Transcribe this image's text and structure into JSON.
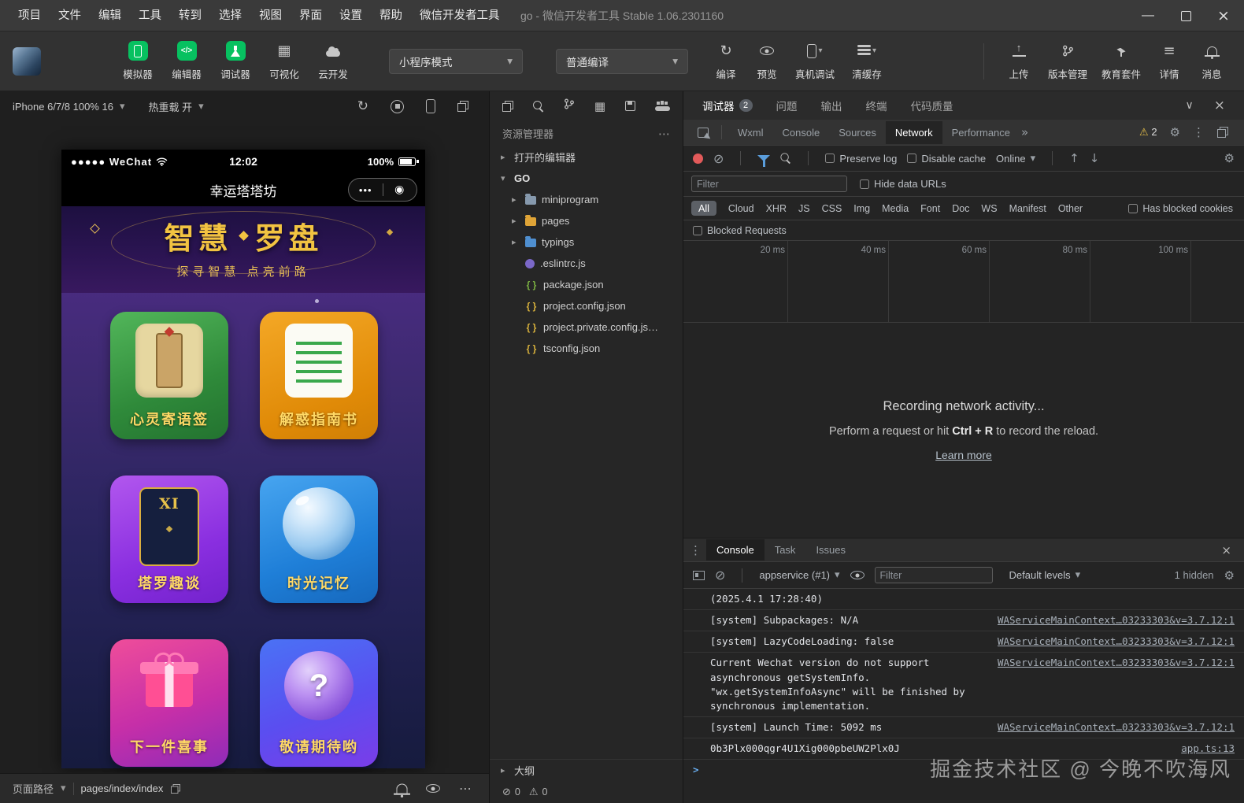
{
  "window": {
    "menu": [
      "项目",
      "文件",
      "编辑",
      "工具",
      "转到",
      "选择",
      "视图",
      "界面",
      "设置",
      "帮助",
      "微信开发者工具"
    ],
    "title": "go - 微信开发者工具 Stable 1.06.2301160"
  },
  "toolbar": {
    "simulator": "模拟器",
    "editor": "编辑器",
    "debugger": "调试器",
    "visual": "可视化",
    "cloud": "云开发",
    "mode_select": "小程序模式",
    "compile_select": "普通编译",
    "compile": "编译",
    "preview": "预览",
    "device_debug": "真机调试",
    "clear_cache": "清缓存",
    "upload": "上传",
    "version": "版本管理",
    "edu": "教育套件",
    "details": "详情",
    "messages": "消息"
  },
  "simulator": {
    "device": "iPhone 6/7/8 100% 16",
    "hot_reload": "热重载 开",
    "page_path_label": "页面路径",
    "page_path": "pages/index/index",
    "phone": {
      "carrier": "●●●●● WeChat",
      "time": "12:02",
      "battery": "100%",
      "nav_title": "幸运塔塔坊",
      "banner_title_left": "智慧",
      "banner_title_right": "罗盘",
      "banner_subtitle": "探寻智慧 点亮前路",
      "cards": [
        {
          "label": "心灵寄语签"
        },
        {
          "label": "解惑指南书"
        },
        {
          "label": "塔罗趣谈",
          "icon_text": "XI"
        },
        {
          "label": "时光记忆"
        },
        {
          "label": "下一件喜事"
        },
        {
          "label": "敬请期待哟",
          "icon_text": "?"
        }
      ]
    }
  },
  "explorer": {
    "title": "资源管理器",
    "open_editors": "打开的编辑器",
    "project": "GO",
    "items": [
      "miniprogram",
      "pages",
      "typings",
      ".eslintrc.js",
      "package.json",
      "project.config.json",
      "project.private.config.js…",
      "tsconfig.json"
    ],
    "outline": "大纲",
    "errors": "0",
    "warnings": "0"
  },
  "debugger": {
    "tabs": [
      "调试器",
      "问题",
      "输出",
      "终端",
      "代码质量"
    ],
    "badge": "2",
    "devtools_tabs": [
      "Wxml",
      "Console",
      "Sources",
      "Network",
      "Performance"
    ],
    "warn_count": "2",
    "network": {
      "preserve_log": "Preserve log",
      "disable_cache": "Disable cache",
      "throttling": "Online",
      "filter_placeholder": "Filter",
      "hide_data_urls": "Hide data URLs",
      "type_filters": [
        "All",
        "Cloud",
        "XHR",
        "JS",
        "CSS",
        "Img",
        "Media",
        "Font",
        "Doc",
        "WS",
        "Manifest",
        "Other"
      ],
      "has_blocked_cookies": "Has blocked cookies",
      "blocked_requests": "Blocked Requests",
      "timeline_ticks": [
        "20 ms",
        "40 ms",
        "60 ms",
        "80 ms",
        "100 ms"
      ],
      "empty_title": "Recording network activity...",
      "empty_pre": "Perform a request or hit ",
      "empty_key": "Ctrl + R",
      "empty_post": " to record the reload.",
      "learn_more": "Learn more"
    }
  },
  "console": {
    "tabs": [
      "Console",
      "Task",
      "Issues"
    ],
    "context": "appservice (#1)",
    "filter_placeholder": "Filter",
    "levels": "Default levels",
    "hidden": "1 hidden",
    "rows": [
      {
        "text": "(2025.4.1 17:28:40)",
        "link": ""
      },
      {
        "text": "[system] Subpackages: N/A",
        "link": "WAServiceMainContext…03233303&v=3.7.12:1"
      },
      {
        "text": "[system] LazyCodeLoading: false",
        "link": "WAServiceMainContext…03233303&v=3.7.12:1"
      },
      {
        "text": "Current Wechat version do not support asynchronous getSystemInfo. \"wx.getSystemInfoAsync\" will be finished by synchronous implementation.",
        "link": "WAServiceMainContext…03233303&v=3.7.12:1"
      },
      {
        "text": "[system] Launch Time: 5092 ms",
        "link": "WAServiceMainContext…03233303&v=3.7.12:1"
      },
      {
        "text": "0b3Plx000qgr4U1Xig000pbeUW2Plx0J",
        "link": "app.ts:13"
      }
    ]
  },
  "watermark": "掘金技术社区 @ 今晚不吹海风"
}
